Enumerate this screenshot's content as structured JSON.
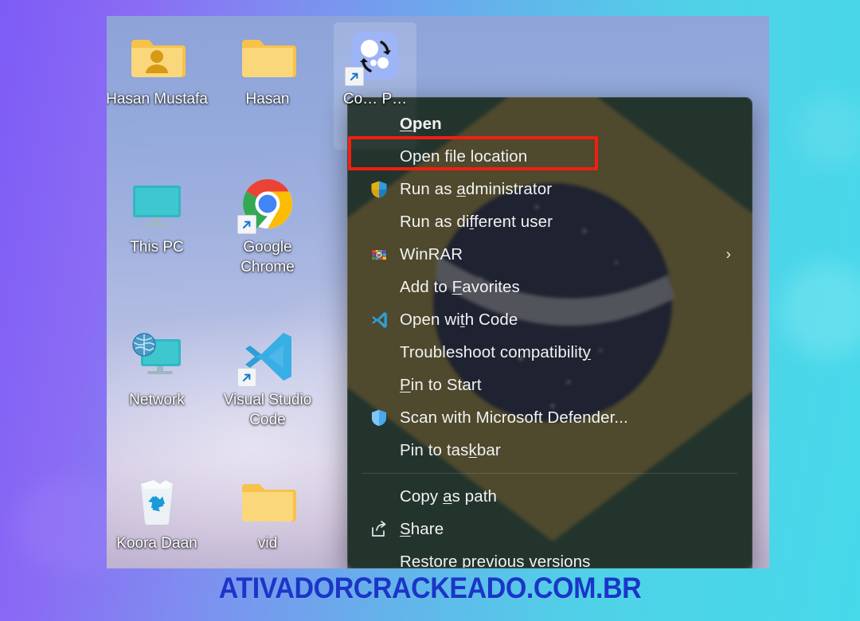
{
  "page": {
    "watermark": "ATIVADORCRACKEADO.COM.BR",
    "background_left_color": "#7d5bf6",
    "background_right_color": "#46d9ea",
    "watermark_color": "#1b35c8"
  },
  "desktop": {
    "icons": [
      {
        "label": "Hasan Mustafa",
        "icon": "user-folder-icon",
        "shortcut": false,
        "selected": false
      },
      {
        "label": "Hasan",
        "icon": "folder-icon",
        "shortcut": false,
        "selected": false
      },
      {
        "label": "Co… P…",
        "icon": "converter-app-icon",
        "shortcut": true,
        "selected": true
      },
      {
        "label": "This PC",
        "icon": "this-pc-icon",
        "shortcut": false,
        "selected": false
      },
      {
        "label": "Google Chrome",
        "icon": "google-chrome-icon",
        "shortcut": true,
        "selected": false
      },
      {
        "label": "Network",
        "icon": "network-icon",
        "shortcut": false,
        "selected": false
      },
      {
        "label": "Visual Studio Code",
        "icon": "visual-studio-code-icon",
        "shortcut": true,
        "selected": false
      },
      {
        "label": "Koora Daan",
        "icon": "recycle-bin-icon",
        "shortcut": false,
        "selected": false
      },
      {
        "label": "vid",
        "icon": "folder-icon",
        "shortcut": false,
        "selected": false
      }
    ]
  },
  "context_menu": {
    "highlight_color": "#f01f12",
    "highlighted_item": "Open file location",
    "items": [
      {
        "label": "Open",
        "icon": null,
        "bold": true,
        "accel": "O",
        "submenu": false
      },
      {
        "label": "Open file location",
        "icon": null,
        "bold": false,
        "accel": null,
        "submenu": false
      },
      {
        "label": "Run as administrator",
        "icon": "uac-shield-icon",
        "bold": false,
        "accel": "a",
        "submenu": false
      },
      {
        "label": "Run as different user",
        "icon": null,
        "bold": false,
        "accel": "f",
        "submenu": false
      },
      {
        "label": "WinRAR",
        "icon": "winrar-icon",
        "bold": false,
        "accel": null,
        "submenu": true
      },
      {
        "label": "Add to Favorites",
        "icon": null,
        "bold": false,
        "accel": "F",
        "submenu": false
      },
      {
        "label": "Open with Code",
        "icon": "vscode-icon",
        "bold": false,
        "accel": null,
        "submenu": false
      },
      {
        "label": "Troubleshoot compatibility",
        "icon": null,
        "bold": false,
        "accel": "y",
        "submenu": false
      },
      {
        "label": "Pin to Start",
        "icon": null,
        "bold": false,
        "accel": "P",
        "submenu": false
      },
      {
        "label": "Scan with Microsoft Defender...",
        "icon": "defender-shield-icon",
        "bold": false,
        "accel": null,
        "submenu": false
      },
      {
        "label": "Pin to taskbar",
        "icon": null,
        "bold": false,
        "accel": "k",
        "submenu": false
      },
      {
        "separator": true
      },
      {
        "label": "Copy as path",
        "icon": null,
        "bold": false,
        "accel": "a",
        "submenu": false
      },
      {
        "label": "Share",
        "icon": "share-icon",
        "bold": false,
        "accel": "S",
        "submenu": false
      },
      {
        "label": "Restore previous versions",
        "icon": null,
        "bold": false,
        "accel": "v",
        "submenu": false
      }
    ],
    "submenu_chevron": "›"
  }
}
